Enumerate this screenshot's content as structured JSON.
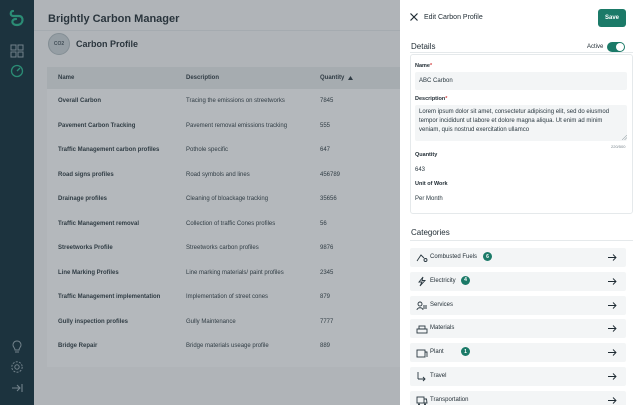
{
  "app": {
    "title": "Brightly Carbon Manager"
  },
  "page": {
    "avatar_text": "CO2",
    "title": "Carbon Profile"
  },
  "table": {
    "columns": [
      "Name",
      "Description",
      "Quantity"
    ],
    "rows": [
      [
        "Overall Carbon",
        "Tracing the emissions on streetworks",
        "7845"
      ],
      [
        "Pavement Carbon Tracking",
        "Pavement removal emissions tracking",
        "555"
      ],
      [
        "Traffic Management carbon profiles",
        "Pothole specific",
        "647"
      ],
      [
        "Road signs profiles",
        "Road symbols and lines",
        "456789"
      ],
      [
        "Drainage profiles",
        "Cleaning of bloackage tracking",
        "35656"
      ],
      [
        "Traffic Management removal",
        "Collection of traffic Cones profiles",
        "56"
      ],
      [
        "Streetworks Profile",
        "Streetworks carbon profiles",
        "9876"
      ],
      [
        "Line Marking Profiles",
        "Line marking materials/ paint profiles",
        "2345"
      ],
      [
        "Traffic Management implementation",
        "Implementation of street cones",
        "879"
      ],
      [
        "Gully inspection profiles",
        "Gully Maintenance",
        "7777"
      ],
      [
        "Bridge Repair",
        "Bridge materials useage profile",
        "889"
      ]
    ]
  },
  "panel": {
    "title": "Edit Carbon Profile",
    "save_label": "Save",
    "details_label": "Details",
    "active_label": "Active",
    "active": true,
    "name_label": "Name",
    "name_value": "ABC Carbon",
    "description_label": "Description",
    "description_value": "Lorem ipsum dolor sit amet, consectetur adipiscing elit, sed do eiusmod tempor incididunt ut labore et dolore magna aliqua. Ut enim ad minim veniam, quis nostrud exercitation ullamco",
    "char_count": "220/500",
    "quantity_label": "Quantity",
    "quantity_value": "643",
    "unit_label": "Unit of Work",
    "unit_value": "Per Month",
    "categories_label": "Categories",
    "categories": [
      {
        "name": "Combusted Fuels",
        "badge": "6",
        "icon": "fuel-icon"
      },
      {
        "name": "Electricity",
        "badge": "4",
        "icon": "lightning-icon"
      },
      {
        "name": "Services",
        "badge": "",
        "icon": "services-icon"
      },
      {
        "name": "Materials",
        "badge": "",
        "icon": "materials-icon"
      },
      {
        "name": "Plant",
        "badge": "1",
        "icon": "plant-icon"
      },
      {
        "name": "Travel",
        "badge": "",
        "icon": "travel-icon"
      },
      {
        "name": "Transportation",
        "badge": "",
        "icon": "truck-icon"
      }
    ]
  },
  "colors": {
    "accent": "#1b7a68",
    "rail": "#0b2a36",
    "required": "#d64545"
  }
}
